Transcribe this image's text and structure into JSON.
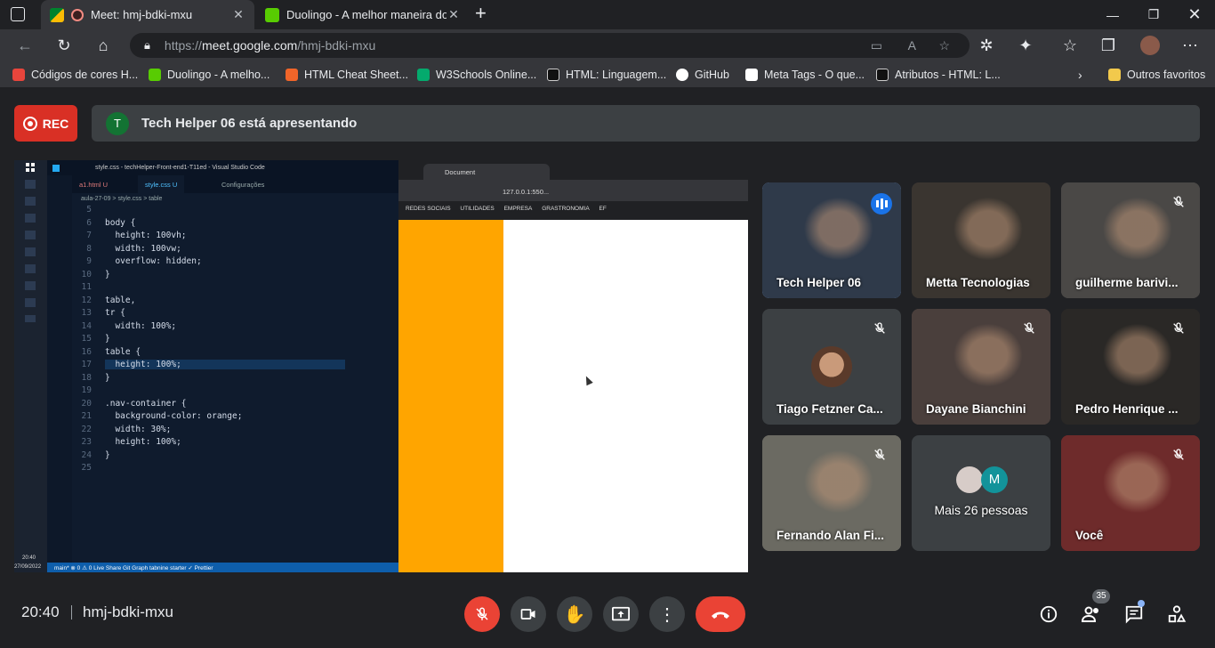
{
  "browser": {
    "tabs": [
      {
        "title": "Meet: hmj-bdki-mxu",
        "active": true
      },
      {
        "title": "Duolingo - A melhor maneira do",
        "active": false
      }
    ],
    "new_tab": "+",
    "url_prefix": "https://",
    "url_host": "meet.google.com",
    "url_path": "/hmj-bdki-mxu",
    "bookmarks": [
      {
        "label": "Códigos de cores H...",
        "color": "#e8453c"
      },
      {
        "label": "Duolingo - A melho...",
        "color": "#58cc02"
      },
      {
        "label": "HTML Cheat Sheet...",
        "color": "#f16529"
      },
      {
        "label": "W3Schools Online...",
        "color": "#04aa6d"
      },
      {
        "label": "HTML: Linguagem...",
        "color": "#1b1b1b"
      },
      {
        "label": "GitHub",
        "color": "#ffffff"
      },
      {
        "label": "Meta Tags - O que...",
        "color": "#ffffff"
      },
      {
        "label": "Atributos - HTML: L...",
        "color": "#1b1b1b"
      }
    ],
    "other_favorites": "Outros favoritos"
  },
  "meet": {
    "rec_label": "REC",
    "presenter_initial": "T",
    "presenting_text": "Tech Helper 06 está apresentando",
    "meeting_time": "20:40",
    "meeting_code": "hmj-bdki-mxu",
    "participants_count": "35",
    "accent": "#8ab4f8",
    "danger": "#ea4335",
    "tiles": [
      {
        "name": "Tech Helper 06",
        "muted": false,
        "speaking": true,
        "bg": "#2f3a4a"
      },
      {
        "name": "Metta Tecnologias",
        "muted": false,
        "speaking": false,
        "bg": "#3a3530"
      },
      {
        "name": "guilherme barivi...",
        "muted": true,
        "speaking": false,
        "bg": "#4a4846"
      },
      {
        "name": "Tiago Fetzner Ca...",
        "muted": true,
        "speaking": false,
        "bg": "#3c4043",
        "avatar": true
      },
      {
        "name": "Dayane Bianchini",
        "muted": true,
        "speaking": false,
        "bg": "#4a3f3c"
      },
      {
        "name": "Pedro Henrique ...",
        "muted": true,
        "speaking": false,
        "bg": "#2a2826"
      },
      {
        "name": "Fernando Alan Fi...",
        "muted": true,
        "speaking": false,
        "bg": "#6b6a62"
      },
      {
        "name": "Mais 26 pessoas",
        "muted": false,
        "speaking": false,
        "bg": "#3c4043",
        "more": true,
        "avatar_letter": "M"
      },
      {
        "name": "Você",
        "muted": true,
        "speaking": false,
        "bg": "#6e2b2b"
      }
    ]
  },
  "shared_screen": {
    "vscode_title": "style.css - techHelper-Front-end1-T11ed - Visual Studio Code",
    "tabs": [
      "a1.html U",
      "style.css U",
      "Configurações"
    ],
    "breadcrumb": "aula-27-09 > style.css > table",
    "code_lines": [
      {
        "n": "5",
        "t": ""
      },
      {
        "n": "6",
        "t": "body {"
      },
      {
        "n": "7",
        "t": "  height: 100vh;"
      },
      {
        "n": "8",
        "t": "  width: 100vw;"
      },
      {
        "n": "9",
        "t": "  overflow: hidden;"
      },
      {
        "n": "10",
        "t": "}"
      },
      {
        "n": "11",
        "t": ""
      },
      {
        "n": "12",
        "t": "table,"
      },
      {
        "n": "13",
        "t": "tr {"
      },
      {
        "n": "14",
        "t": "  width: 100%;"
      },
      {
        "n": "15",
        "t": "}"
      },
      {
        "n": "16",
        "t": "table {"
      },
      {
        "n": "17",
        "t": "  height: 100%;"
      },
      {
        "n": "18",
        "t": "}"
      },
      {
        "n": "19",
        "t": ""
      },
      {
        "n": "20",
        "t": ".nav-container {"
      },
      {
        "n": "21",
        "t": "  background-color: orange;"
      },
      {
        "n": "22",
        "t": "  width: 30%;"
      },
      {
        "n": "23",
        "t": "  height: 100%;"
      },
      {
        "n": "24",
        "t": "}"
      },
      {
        "n": "25",
        "t": ""
      }
    ],
    "status": "main*   ⊗ 0 ⚠ 0   Live Share   Git Graph   tabnine starter   ✓ Prettier",
    "taskbar_time": "20:40",
    "taskbar_date": "27/09/2022",
    "inner_tab": "Document",
    "inner_url": "127.0.0.1:550...",
    "inner_bookmarks": [
      "REDES SOCIAIS",
      "UTILIDADES",
      "EMPRESA",
      "GRASTRONOMIA",
      "EF"
    ]
  }
}
